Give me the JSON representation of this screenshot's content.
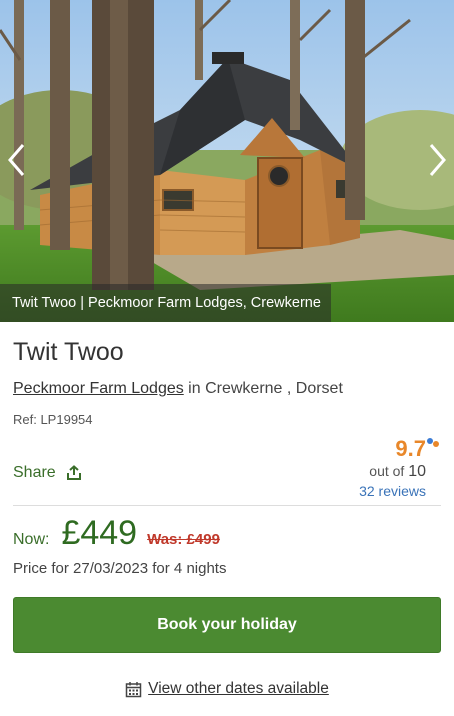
{
  "hero": {
    "caption": "Twit Twoo | Peckmoor Farm Lodges, Crewkerne",
    "prev_icon": "chevron-left-icon",
    "next_icon": "chevron-right-icon"
  },
  "property": {
    "title": "Twit Twoo",
    "site_link": "Peckmoor Farm Lodges",
    "location_rest": " in Crewkerne , Dorset",
    "ref": "Ref: LP19954"
  },
  "share": {
    "label": "Share",
    "icon": "share-icon"
  },
  "rating": {
    "score": "9.7",
    "out_of_prefix": "out of",
    "out_of_value": "10",
    "reviews": "32 reviews",
    "score_color": "#e8872a"
  },
  "price": {
    "now_label": "Now:",
    "now_value": "£449",
    "was": "Was: £499",
    "price_for": "Price for 27/03/2023 for 4 nights"
  },
  "cta": {
    "book_label": "Book your holiday",
    "color": "#4b8a31"
  },
  "dates": {
    "icon": "calendar-icon",
    "link": "View other dates available"
  }
}
